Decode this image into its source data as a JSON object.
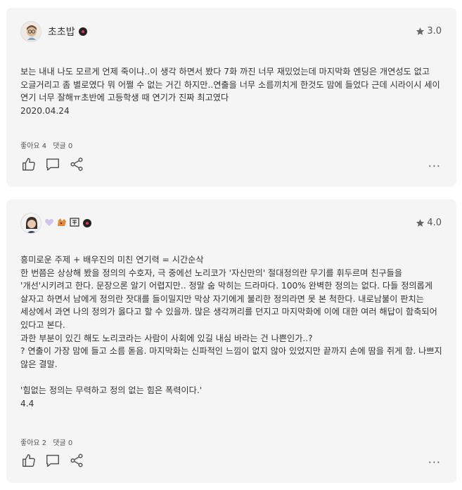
{
  "reviews": [
    {
      "username": "초초밥",
      "rating": "3.0",
      "text": "보는 내내 나도 모르게 언제 죽이냐..이 생각 하면서 봤다 7화 까진 너무 재밌었는데 마지막화 엔딩은 개연성도 없고 오글거리고 좀 별로였다 뭐 어쩔 수 없는 거긴 하지만..연출을 너무 소름끼치게 한것도 맘에 들었다 근데 시라이시 세이 연기 너무 잘해ㅠ초반에 고등학생 때 연기가 진짜 최고였다\n2020.04.24",
      "likes_label": "좋아요 4",
      "comments_label": "댓글 0",
      "more": "···"
    },
    {
      "username": "",
      "rating": "4.0",
      "text": "흥미로운 주제 + 배우진의 미친 연기력 = 시간순삭\n한 번쯤은 상상해 봤을 정의의 수호자, 극 중에선 노리코가 '자신만의' 절대정의란 무기를 휘두르며 친구들을 '개선'시키려고 한다. 문장으론 알기 어렵지만.. 정말 숨 막히는 드라마다. 100% 완벽한 정의는 없다. 다들 정의롭게 살자고 하면서 남에게 정의란 잣대를 들이밀지만 막상 자기에게 불리한 정의라면 못 본 척한다. 내로남불이 판치는 세상에서 과연 나의 정의가 옳다고 할 수 있을까. 많은 생각꺼리를 던지고 마지막화에 이에 대한 여러 해답이 함축되어 있다고 본다.\n과한 부분이 있긴 해도 노리코라는 사람이 사회에 있길 내심 바라는 건 나쁜인가..?\n? 연출이 가장 맘에 들고 소름 돋음. 마지막화는 신파적인 느낌이 없지 않아 있었지만 끝까지 손에 땀을 쥐게 함. 나쁘지 않은 결말.\n\n'힘없는 정의는 무력하고 정의 없는 힘은 폭력이다.'\n4.4",
      "likes_label": "좋아요 2",
      "comments_label": "댓글 0",
      "more": "···"
    }
  ],
  "icons": {
    "star": "star-icon",
    "like": "thumbs-up-icon",
    "comment": "comment-icon",
    "share": "share-icon",
    "more": "more-icon"
  },
  "colors": {
    "card_bg": "#f5f5f5",
    "badge_dot": "#e0335b"
  }
}
